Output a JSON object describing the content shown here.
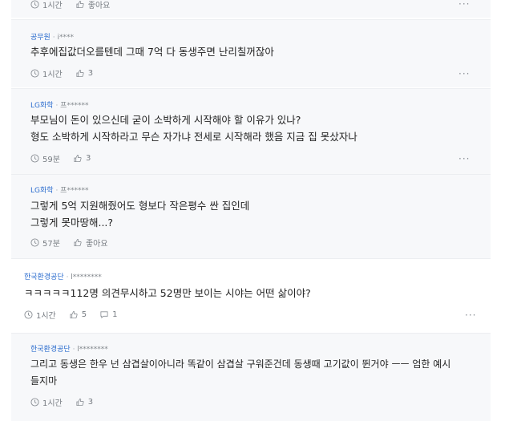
{
  "more_label": "···",
  "comments": [
    {
      "org": "",
      "user": "",
      "lines": [],
      "time": "1시간",
      "likes": "좋아요",
      "replies": ""
    },
    {
      "org": "공무원",
      "user": "i****",
      "lines": [
        "추후에집값더오를텐데 그때 7억 다 동생주면 난리칠꺼잖아"
      ],
      "time": "1시간",
      "likes": "3",
      "replies": ""
    },
    {
      "org": "LG화학",
      "user": "프******",
      "lines": [
        "부모님이 돈이 있으신데 굳이 소박하게 시작해야 할 이유가 있나?",
        "형도 소박하게 시작하라고 무슨 자가냐 전세로 시작해라 했음 지금 집 못샀자나"
      ],
      "time": "59분",
      "likes": "3",
      "replies": ""
    },
    {
      "org": "LG화학",
      "user": "프******",
      "lines": [
        "그렇게 5억 지원해줬어도 형보다 작은평수 싼 집인데",
        "그렇게 못마땅해...?"
      ],
      "time": "57분",
      "likes": "좋아요",
      "replies": ""
    },
    {
      "org": "한국환경공단",
      "user": "l********",
      "lines": [
        "ㅋㅋㅋㅋㅋ112명 의견무시하고 52명만 보이는 시야는 어떤 삶이야?"
      ],
      "time": "1시간",
      "likes": "5",
      "replies": "1"
    },
    {
      "org": "한국환경공단",
      "user": "l********",
      "lines": [
        "그리고 동생은 한우 넌 삼겹살이아니라 똑같이 삼겹살 구워준건데 동생때 고기값이 뛴거야 ㅡㅡ 엄한 예시",
        "들지마"
      ],
      "time": "1시간",
      "likes": "3",
      "replies": ""
    }
  ]
}
